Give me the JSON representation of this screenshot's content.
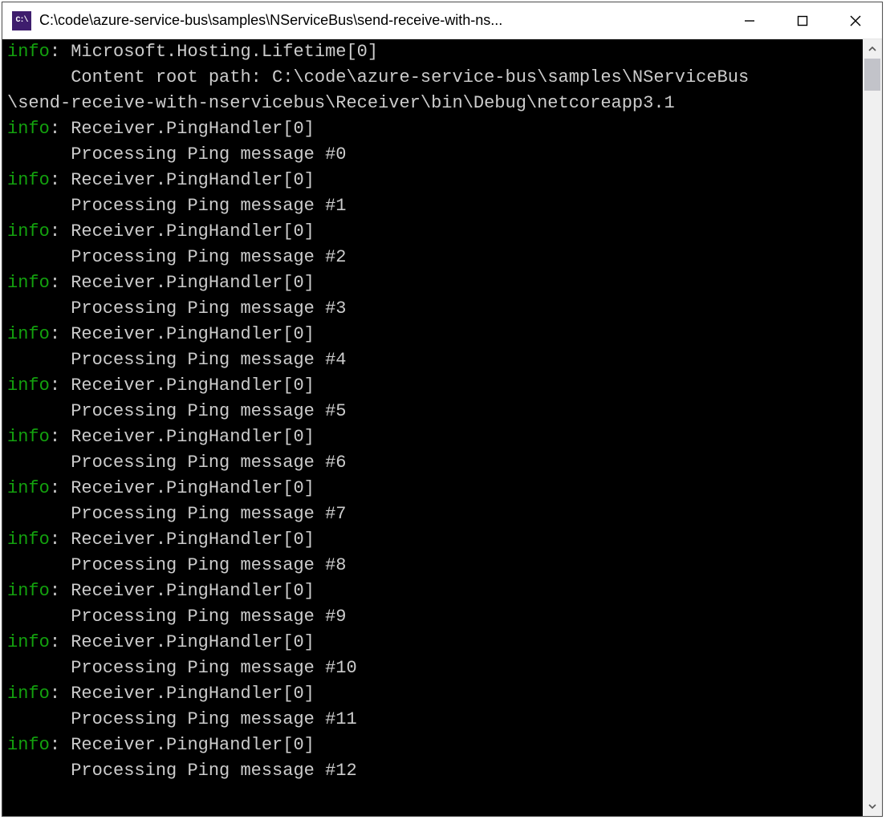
{
  "window": {
    "title": "C:\\code\\azure-service-bus\\samples\\NServiceBus\\send-receive-with-ns..."
  },
  "labels": {
    "info": "info"
  },
  "log": {
    "first": {
      "source": "Microsoft.Hosting.Lifetime[0]",
      "wrapped_line1": "      Content root path: C:\\code\\azure-service-bus\\samples\\NServiceBus",
      "wrapped_line2": "\\send-receive-with-nservicebus\\Receiver\\bin\\Debug\\netcoreapp3.1"
    },
    "entries": [
      {
        "source": "Receiver.PingHandler[0]",
        "message": "Processing Ping message #0"
      },
      {
        "source": "Receiver.PingHandler[0]",
        "message": "Processing Ping message #1"
      },
      {
        "source": "Receiver.PingHandler[0]",
        "message": "Processing Ping message #2"
      },
      {
        "source": "Receiver.PingHandler[0]",
        "message": "Processing Ping message #3"
      },
      {
        "source": "Receiver.PingHandler[0]",
        "message": "Processing Ping message #4"
      },
      {
        "source": "Receiver.PingHandler[0]",
        "message": "Processing Ping message #5"
      },
      {
        "source": "Receiver.PingHandler[0]",
        "message": "Processing Ping message #6"
      },
      {
        "source": "Receiver.PingHandler[0]",
        "message": "Processing Ping message #7"
      },
      {
        "source": "Receiver.PingHandler[0]",
        "message": "Processing Ping message #8"
      },
      {
        "source": "Receiver.PingHandler[0]",
        "message": "Processing Ping message #9"
      },
      {
        "source": "Receiver.PingHandler[0]",
        "message": "Processing Ping message #10"
      },
      {
        "source": "Receiver.PingHandler[0]",
        "message": "Processing Ping message #11"
      },
      {
        "source": "Receiver.PingHandler[0]",
        "message": "Processing Ping message #12"
      }
    ]
  }
}
